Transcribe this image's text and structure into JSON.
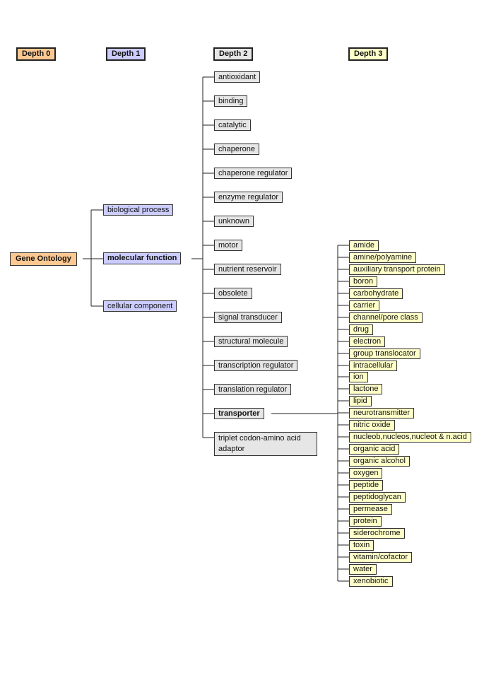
{
  "headers": [
    "Depth 0",
    "Depth 1",
    "Depth 2",
    "Depth 3"
  ],
  "colors": {
    "depth0": "#fcc891",
    "depth1": "#ccccff",
    "depth2": "#e6e6e6",
    "depth3": "#ffffc8",
    "line": "#222222"
  },
  "root": {
    "label": "Gene Ontology"
  },
  "depth1": [
    {
      "label": "biological process",
      "bold": false
    },
    {
      "label": "molecular function",
      "bold": true
    },
    {
      "label": "cellular component",
      "bold": false
    }
  ],
  "depth2": [
    {
      "label": "antioxidant"
    },
    {
      "label": "binding"
    },
    {
      "label": "catalytic"
    },
    {
      "label": "chaperone"
    },
    {
      "label": "chaperone regulator"
    },
    {
      "label": "enzyme regulator"
    },
    {
      "label": "unknown"
    },
    {
      "label": "motor"
    },
    {
      "label": "nutrient reservoir"
    },
    {
      "label": "obsolete"
    },
    {
      "label": "signal transducer"
    },
    {
      "label": "structural molecule"
    },
    {
      "label": "transcription regulator"
    },
    {
      "label": "translation regulator"
    },
    {
      "label": "transporter",
      "bold": true
    },
    {
      "label": "triplet codon-amino acid adaptor"
    }
  ],
  "depth3": [
    "amide",
    "amine/polyamine",
    "auxiliary transport protein",
    "boron",
    "carbohydrate",
    "carrier",
    "channel/pore class",
    "drug",
    "electron",
    "group translocator",
    "intracellular",
    "ion",
    "lactone",
    "lipid",
    "neurotransmitter",
    "nitric oxide",
    "nucleob,nucleos,nucleot & n.acid",
    "organic acid",
    "organic alcohol",
    "oxygen",
    "peptide",
    "peptidoglycan",
    "permease",
    "protein",
    "siderochrome",
    "toxin",
    "vitamin/cofactor",
    "water",
    "xenobiotic"
  ]
}
